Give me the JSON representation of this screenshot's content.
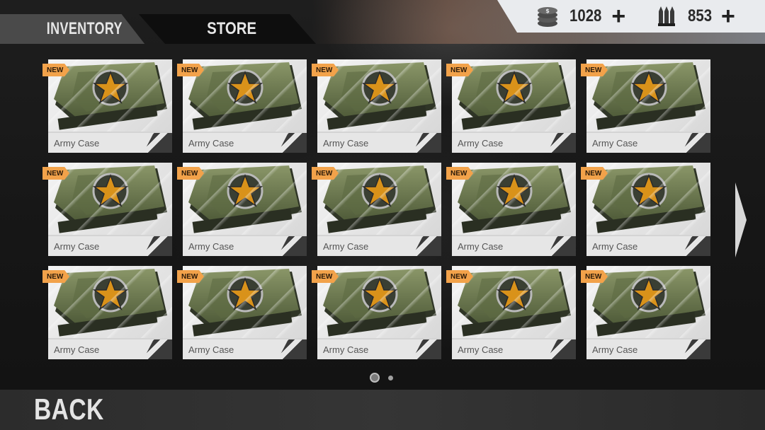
{
  "tabs": [
    {
      "label": "INVENTORY",
      "active": true
    },
    {
      "label": "STORE",
      "active": false
    }
  ],
  "currency": {
    "coins": {
      "icon": "coin-stack-icon",
      "value": "1028"
    },
    "ammo": {
      "icon": "bullets-icon",
      "value": "853"
    }
  },
  "grid": {
    "items": [
      {
        "name": "Army Case",
        "badge": "NEW"
      },
      {
        "name": "Army Case",
        "badge": "NEW"
      },
      {
        "name": "Army Case",
        "badge": "NEW"
      },
      {
        "name": "Army Case",
        "badge": "NEW"
      },
      {
        "name": "Army Case",
        "badge": "NEW"
      },
      {
        "name": "Army Case",
        "badge": "NEW"
      },
      {
        "name": "Army Case",
        "badge": "NEW"
      },
      {
        "name": "Army Case",
        "badge": "NEW"
      },
      {
        "name": "Army Case",
        "badge": "NEW"
      },
      {
        "name": "Army Case",
        "badge": "NEW"
      },
      {
        "name": "Army Case",
        "badge": "NEW"
      },
      {
        "name": "Army Case",
        "badge": "NEW"
      },
      {
        "name": "Army Case",
        "badge": "NEW"
      },
      {
        "name": "Army Case",
        "badge": "NEW"
      },
      {
        "name": "Army Case",
        "badge": "NEW"
      }
    ]
  },
  "pagination": {
    "current": 1,
    "total": 2
  },
  "back_label": "BACK",
  "colors": {
    "badge": "#f2a24a",
    "case_green": "#6b7a4e",
    "star": "#d9921a"
  }
}
